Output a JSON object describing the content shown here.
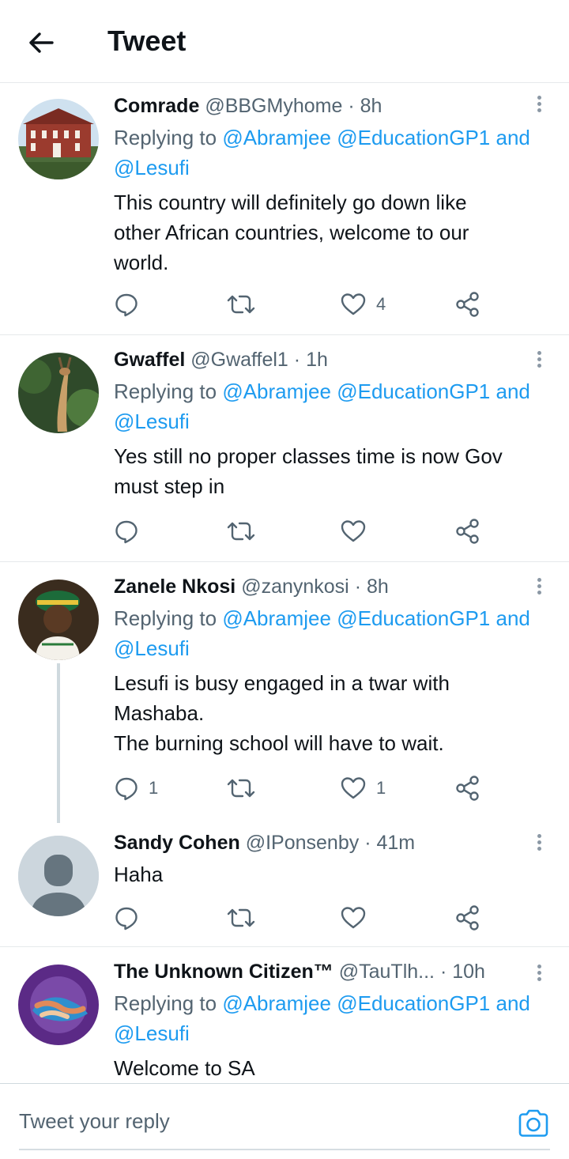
{
  "header": {
    "title": "Tweet"
  },
  "colors": {
    "link": "#1d9bf0",
    "secondary_text": "#536471",
    "divider": "#e6e9eb"
  },
  "tweets": [
    {
      "name": "Comrade",
      "handle": "@BBGMyhome",
      "time": "· 8h",
      "reply_prefix": "Replying to",
      "reply_targets": "@Abramjee @EducationGP1 and",
      "reply_targets_2": "@Lesufi",
      "lines": [
        "This country will definitely go down like",
        "other African countries, welcome to our",
        "world."
      ],
      "reply_count": "",
      "like_count": "4"
    },
    {
      "name": "Gwaffel",
      "handle": "@Gwaffel1",
      "time": "· 1h",
      "reply_prefix": "Replying to",
      "reply_targets": "@Abramjee @EducationGP1 and",
      "reply_targets_2": "@Lesufi",
      "lines": [
        "Yes still no proper classes time is now Gov",
        "must step in"
      ],
      "reply_count": "",
      "like_count": ""
    },
    {
      "name": "Zanele Nkosi",
      "handle": "@zanynkosi",
      "time": "· 8h",
      "reply_prefix": "Replying to",
      "reply_targets": "@Abramjee @EducationGP1 and",
      "reply_targets_2": "@Lesufi",
      "lines": [
        "Lesufi is busy engaged in a twar with",
        "Mashaba.",
        "The burning school will have to wait."
      ],
      "reply_count": "1",
      "like_count": "1"
    },
    {
      "name": "Sandy Cohen",
      "handle": "@IPonsenby",
      "time": "· 41m",
      "lines": [
        "Haha"
      ],
      "reply_count": "",
      "like_count": ""
    },
    {
      "name": "The Unknown Citizen™",
      "handle": "@TauTlh...",
      "time": "· 10h",
      "reply_prefix": "Replying to",
      "reply_targets": "@Abramjee @EducationGP1 and",
      "reply_targets_2": "@Lesufi",
      "lines": [
        "Welcome to SA"
      ]
    }
  ],
  "reply_bar": {
    "placeholder": "Tweet your reply"
  },
  "icons": [
    "back-arrow-icon",
    "more-icon",
    "reply-icon",
    "retweet-icon",
    "like-icon",
    "share-icon",
    "camera-icon"
  ]
}
